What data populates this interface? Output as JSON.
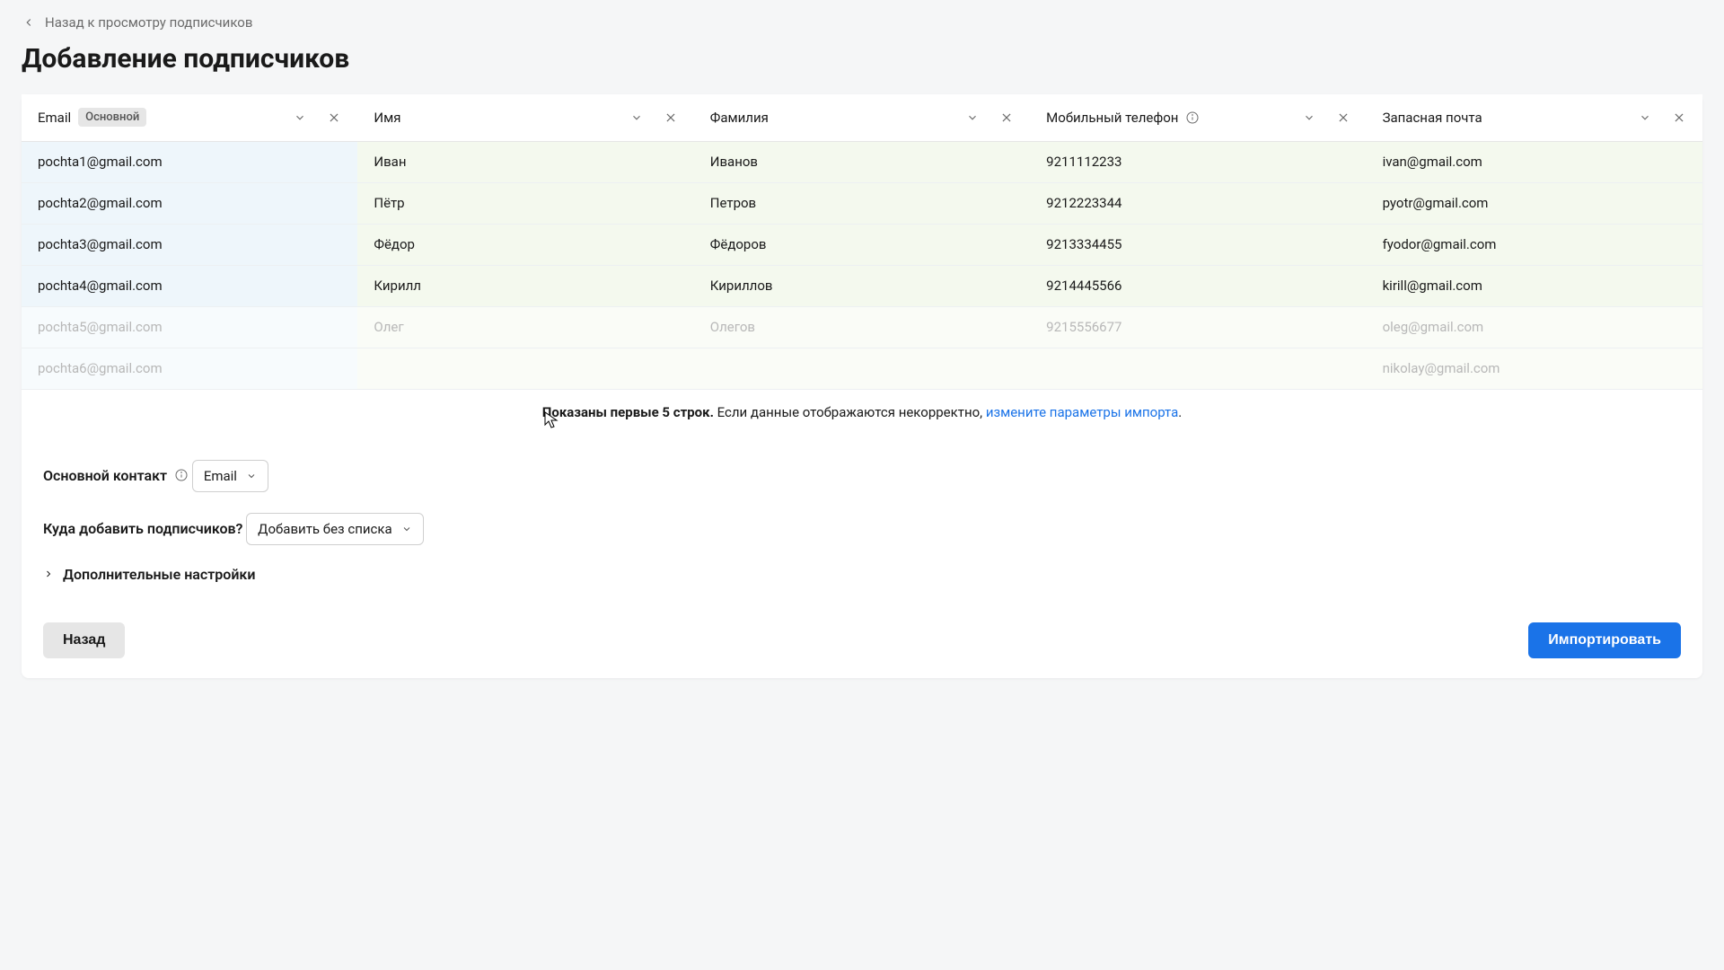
{
  "back_label": "Назад к просмотру подписчиков",
  "page_title": "Добавление подписчиков",
  "columns": [
    {
      "label": "Email",
      "badge": "Основной"
    },
    {
      "label": "Имя"
    },
    {
      "label": "Фамилия"
    },
    {
      "label": "Мобильный телефон",
      "info": true
    },
    {
      "label": "Запасная почта"
    }
  ],
  "rows": [
    {
      "email": "pochta1@gmail.com",
      "name": "Иван",
      "surname": "Иванов",
      "phone": "9211112233",
      "alt": "ivan@gmail.com",
      "dim": false
    },
    {
      "email": "pochta2@gmail.com",
      "name": "Пётр",
      "surname": "Петров",
      "phone": "9212223344",
      "alt": "pyotr@gmail.com",
      "dim": false
    },
    {
      "email": "pochta3@gmail.com",
      "name": "Фёдор",
      "surname": "Фёдоров",
      "phone": "9213334455",
      "alt": "fyodor@gmail.com",
      "dim": false
    },
    {
      "email": "pochta4@gmail.com",
      "name": "Кирилл",
      "surname": "Кириллов",
      "phone": "9214445566",
      "alt": "kirill@gmail.com",
      "dim": false
    },
    {
      "email": "pochta5@gmail.com",
      "name": "Олег",
      "surname": "Олегов",
      "phone": "9215556677",
      "alt": "oleg@gmail.com",
      "dim": true
    },
    {
      "email": "pochta6@gmail.com",
      "name": "",
      "surname": "",
      "phone": "",
      "alt": "nikolay@gmail.com",
      "dim": true
    }
  ],
  "info_strip": {
    "bold": "Показаны первые 5 строк.",
    "rest": " Если данные отображаются некорректно, ",
    "link": "измените параметры импорта",
    "after": "."
  },
  "main_contact_label": "Основной контакт",
  "main_contact_value": "Email",
  "add_to_label": "Куда добавить подписчиков?",
  "add_to_value": "Добавить без списка",
  "advanced_label": "Дополнительные настройки",
  "btn_back": "Назад",
  "btn_import": "Импортировать"
}
